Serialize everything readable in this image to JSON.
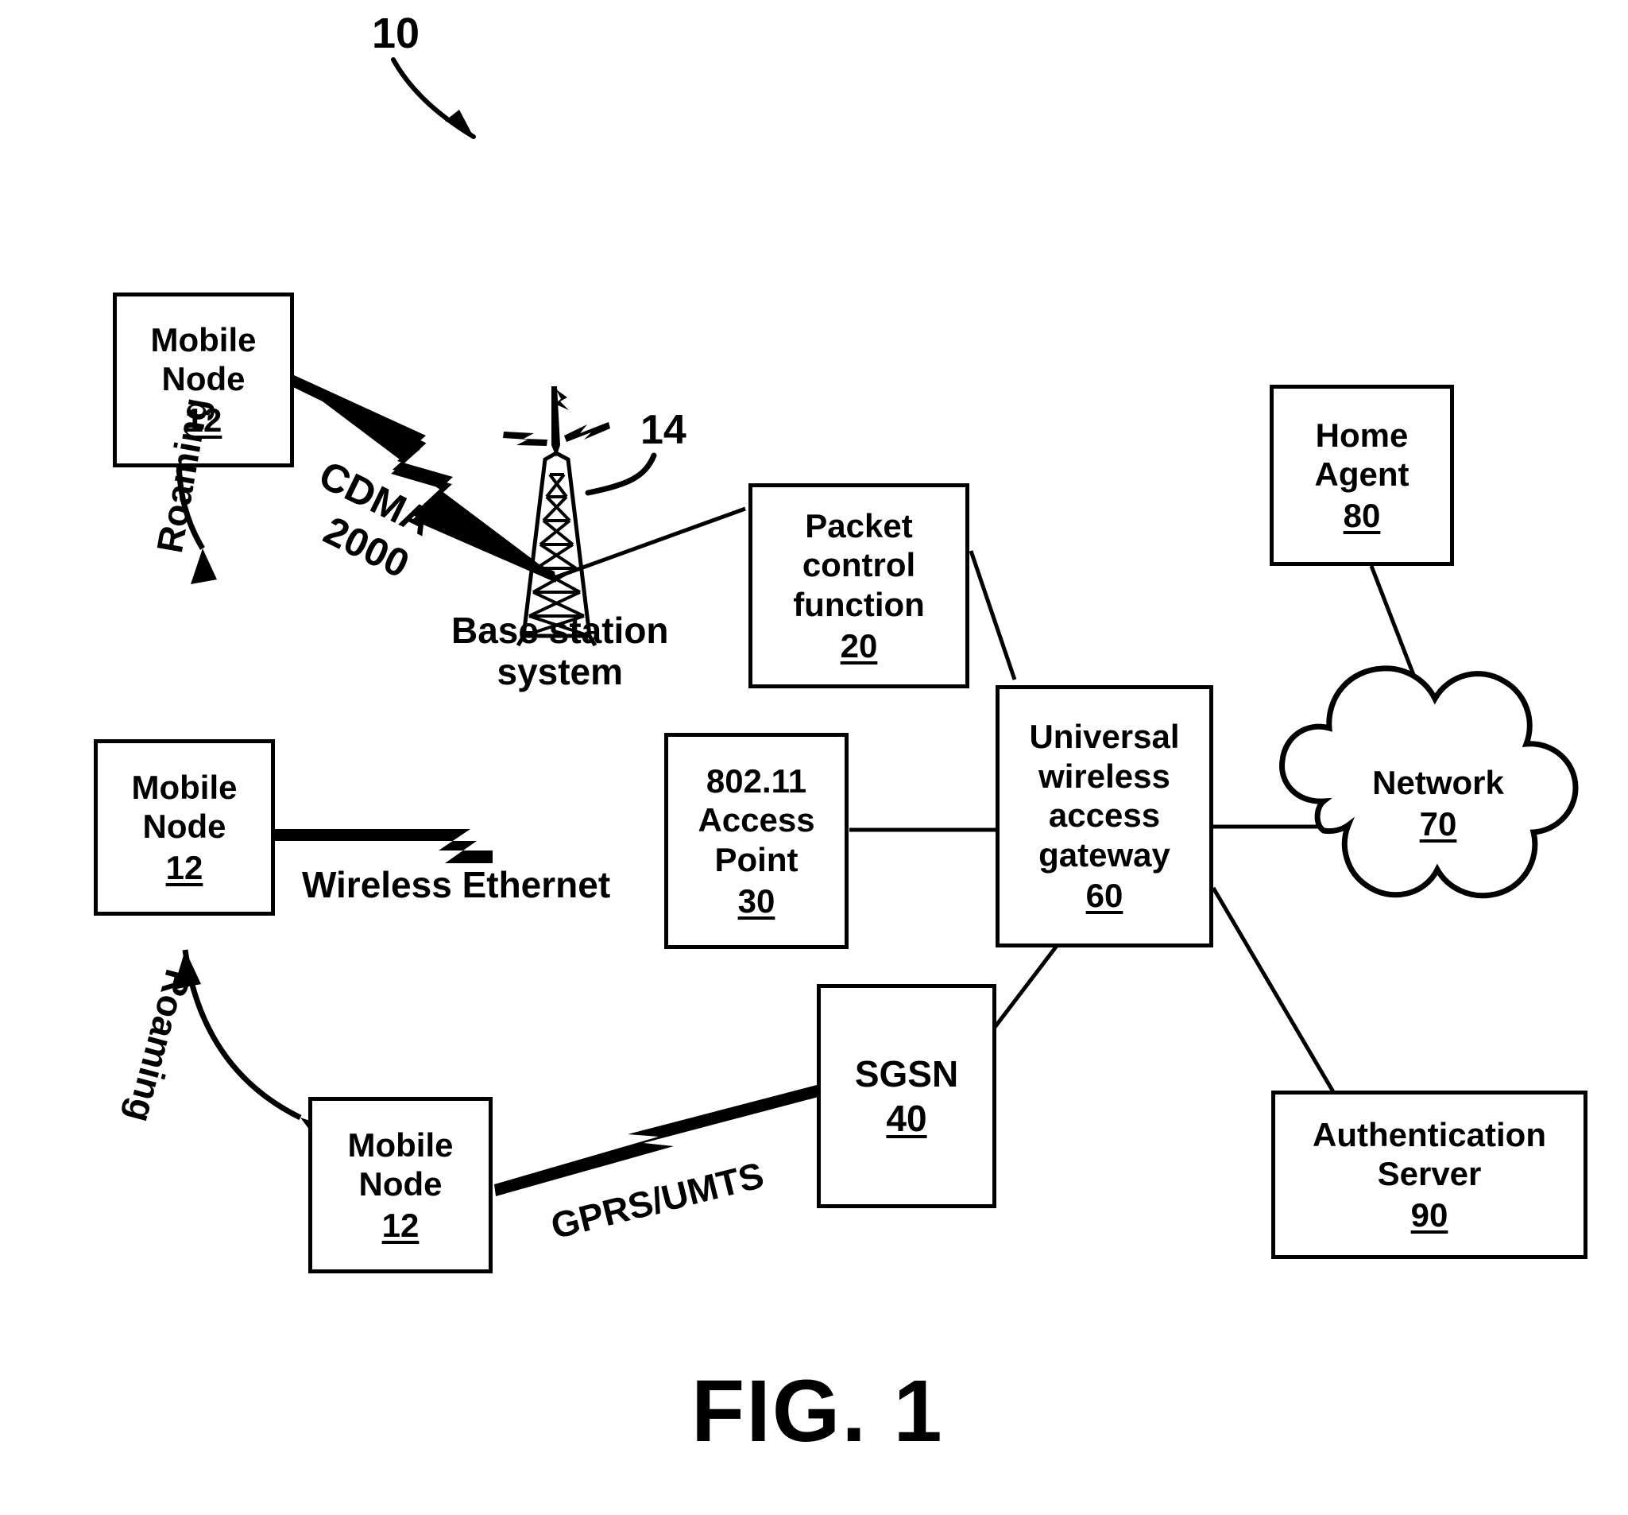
{
  "figure": {
    "caption": "FIG. 1",
    "system_ref": "10",
    "tower_ref": "14"
  },
  "nodes": [
    {
      "id": "mobile-node-top",
      "lines": [
        "Mobile",
        "Node"
      ],
      "ref": "12"
    },
    {
      "id": "mobile-node-middle",
      "lines": [
        "Mobile",
        "Node"
      ],
      "ref": "12"
    },
    {
      "id": "mobile-node-bottom",
      "lines": [
        "Mobile",
        "Node"
      ],
      "ref": "12"
    },
    {
      "id": "packet-control-function",
      "lines": [
        "Packet",
        "control",
        "function"
      ],
      "ref": "20"
    },
    {
      "id": "access-point",
      "lines": [
        "802.11",
        "Access",
        "Point"
      ],
      "ref": "30"
    },
    {
      "id": "sgsn",
      "lines": [
        "SGSN"
      ],
      "ref": "40"
    },
    {
      "id": "universal-wireless-access-gateway",
      "lines": [
        "Universal",
        "wireless",
        "access",
        "gateway"
      ],
      "ref": "60"
    },
    {
      "id": "home-agent",
      "lines": [
        "Home",
        "Agent"
      ],
      "ref": "80"
    },
    {
      "id": "authentication-server",
      "lines": [
        "Authentication",
        "Server"
      ],
      "ref": "90"
    }
  ],
  "cloud": {
    "id": "network-cloud",
    "label": "Network",
    "ref": "70"
  },
  "link_labels": {
    "cdma_line1": "CDMA",
    "cdma_line2": "2000",
    "base_station_line1": "Base station",
    "base_station_line2": "system",
    "wireless_ethernet": "Wireless Ethernet",
    "gprs_umts": "GPRS/UMTS",
    "roaming_upper": "Roaming",
    "roaming_lower": "Roaming"
  },
  "colors": {
    "stroke": "#000000",
    "background": "#ffffff"
  }
}
